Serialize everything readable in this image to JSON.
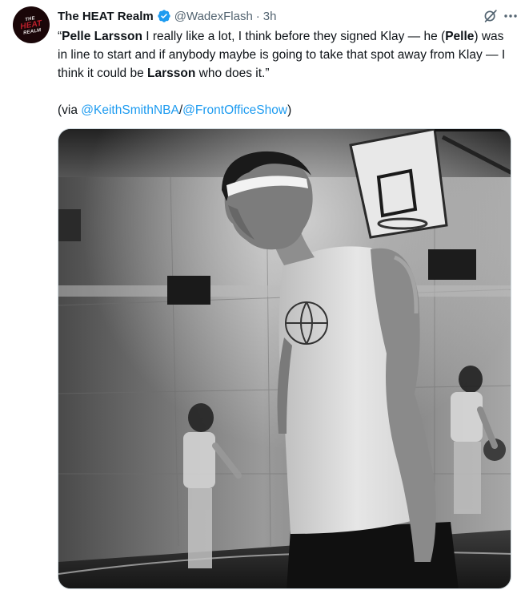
{
  "tweet": {
    "display_name": "The HEAT Realm",
    "handle": "@WadexFlash",
    "separator": "·",
    "timestamp": "3h",
    "avatar_text": {
      "top": "THE",
      "middle": "HEAT",
      "bottom": "REALM"
    },
    "text": {
      "open_quote": "“",
      "bold1": "Pelle Larsson",
      "t1": " I really like a lot, I think before they signed Klay — he (",
      "bold2": "Pelle",
      "t2": ") was in line to start and if anybody maybe is going to take that spot away from Klay — I think it could be ",
      "bold3": "Larsson",
      "t3": " who does it.”"
    },
    "via": {
      "prefix": "(via ",
      "mention1": "@KeithSmithNBA",
      "slash": "/",
      "mention2": "@FrontOfficeShow",
      "suffix": ")"
    }
  },
  "icons": {
    "verified": "verified-badge-icon",
    "grok": "grok-icon",
    "more": "more-options-icon"
  },
  "colors": {
    "text": "#0f1419",
    "secondary": "#536471",
    "link": "#1d9bf0",
    "verified": "#1d9bf0"
  }
}
